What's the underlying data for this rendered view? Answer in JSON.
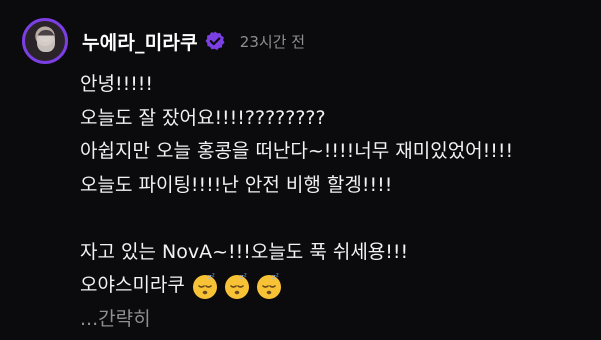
{
  "header": {
    "username": "누에라_미라쿠",
    "timestamp": "23시간 전",
    "verified_icon": "verified-badge-icon",
    "avatar_icon": "avatar"
  },
  "post": {
    "lines": [
      "안녕!!!!!",
      "오늘도 잘 잤어요!!!!????????",
      "아쉽지만 오늘 홍콩을 떠난다~!!!!너무 재미있었어!!!!",
      "오늘도 파이팅!!!!난 안전 비행 할겡!!!!",
      "",
      "자고 있는 NovA~!!!오늘도 푹 쉬세용!!!",
      "오야스미라쿠"
    ],
    "emojis": [
      "sleeping-face-icon",
      "sleeping-face-icon",
      "sleeping-face-icon"
    ],
    "more_label": "...간략히"
  },
  "colors": {
    "background": "#0b0b0d",
    "text": "#f2f2f5",
    "muted": "#8e8e93",
    "accent": "#7b3fe4"
  }
}
